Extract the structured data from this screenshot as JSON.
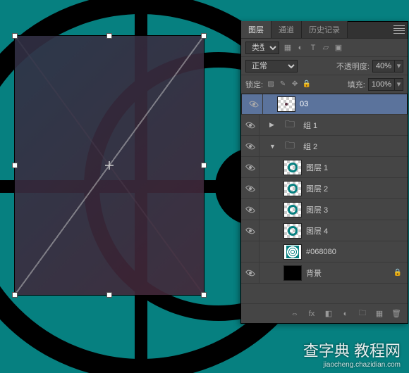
{
  "tabs": {
    "layers": "图层",
    "channels": "通道",
    "history": "历史记录"
  },
  "kind_label": "类型",
  "blend_mode": "正常",
  "opacity_label": "不透明度:",
  "opacity_value": "40%",
  "lock_label": "锁定:",
  "fill_label": "填充:",
  "fill_value": "100%",
  "layers": [
    {
      "name": "03"
    },
    {
      "name": "组 1"
    },
    {
      "name": "组 2"
    },
    {
      "name": "图层 1"
    },
    {
      "name": "图层 2"
    },
    {
      "name": "图层 3"
    },
    {
      "name": "图层 4"
    },
    {
      "name": "#068080"
    },
    {
      "name": "背景"
    }
  ],
  "watermark": {
    "main": "查字典 教程网",
    "sub": "jiaocheng.chazidian.com"
  }
}
